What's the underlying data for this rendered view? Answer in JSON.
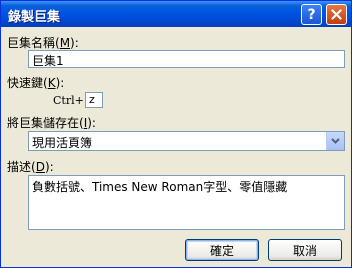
{
  "dialog": {
    "title": "錄製巨集",
    "help_glyph": "?"
  },
  "macro_name": {
    "label": "巨集名稱(",
    "accel": "M",
    "label_end": "):",
    "value": "巨集1"
  },
  "shortcut": {
    "label": "快速鍵(",
    "accel": "K",
    "label_end": "):",
    "prefix": "Ctrl+",
    "value": "z"
  },
  "store_in": {
    "label": "將巨集儲存在(",
    "accel": "I",
    "label_end": "):",
    "selected": "現用活頁簿"
  },
  "description": {
    "label": "描述(",
    "accel": "D",
    "label_end": "):",
    "value": "負數括號、Times New Roman字型、零值隱藏"
  },
  "buttons": {
    "ok": "確定",
    "cancel": "取消"
  }
}
